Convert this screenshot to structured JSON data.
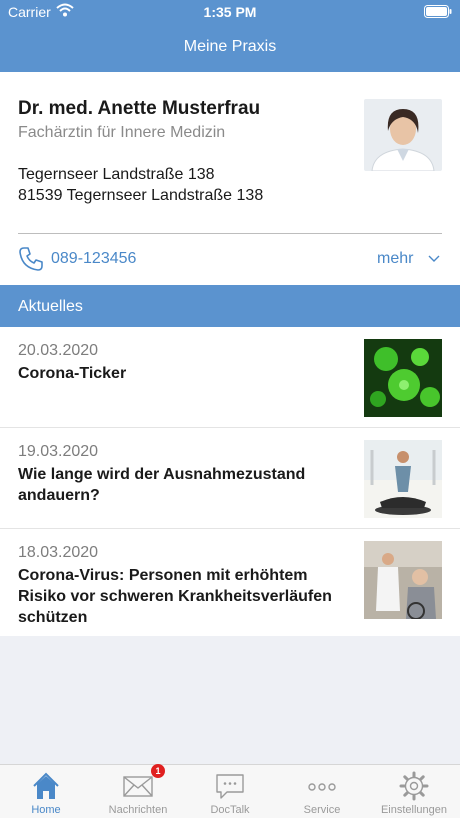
{
  "status_bar": {
    "carrier": "Carrier",
    "time": "1:35 PM"
  },
  "nav": {
    "title": "Meine Praxis"
  },
  "profile": {
    "name": "Dr. med. Anette Musterfrau",
    "specialty": "Fachärztin für Innere Medizin",
    "address_line1": "Tegernseer Landstraße 138",
    "address_line2": "81539 Tegernseer Landstraße 138",
    "phone": "089-123456",
    "more_label": "mehr"
  },
  "section": {
    "title": "Aktuelles"
  },
  "news": [
    {
      "date": "20.03.2020",
      "title": "Corona-Ticker"
    },
    {
      "date": "19.03.2020",
      "title": "Wie lange wird der Ausnahmezustand andauern?"
    },
    {
      "date": "18.03.2020",
      "title": "Corona-Virus: Personen mit erhöhtem Risiko vor schweren Krankheitsverläufen schützen"
    }
  ],
  "tabs": [
    {
      "label": "Home",
      "icon": "home-icon",
      "active": true
    },
    {
      "label": "Nachrichten",
      "icon": "mail-icon",
      "badge": "1"
    },
    {
      "label": "DocTalk",
      "icon": "chat-icon"
    },
    {
      "label": "Service",
      "icon": "more-dots-icon"
    },
    {
      "label": "Einstellungen",
      "icon": "gear-icon"
    }
  ],
  "colors": {
    "brand": "#5b93cf",
    "accent": "#4a88c8",
    "badge": "#e02020"
  }
}
